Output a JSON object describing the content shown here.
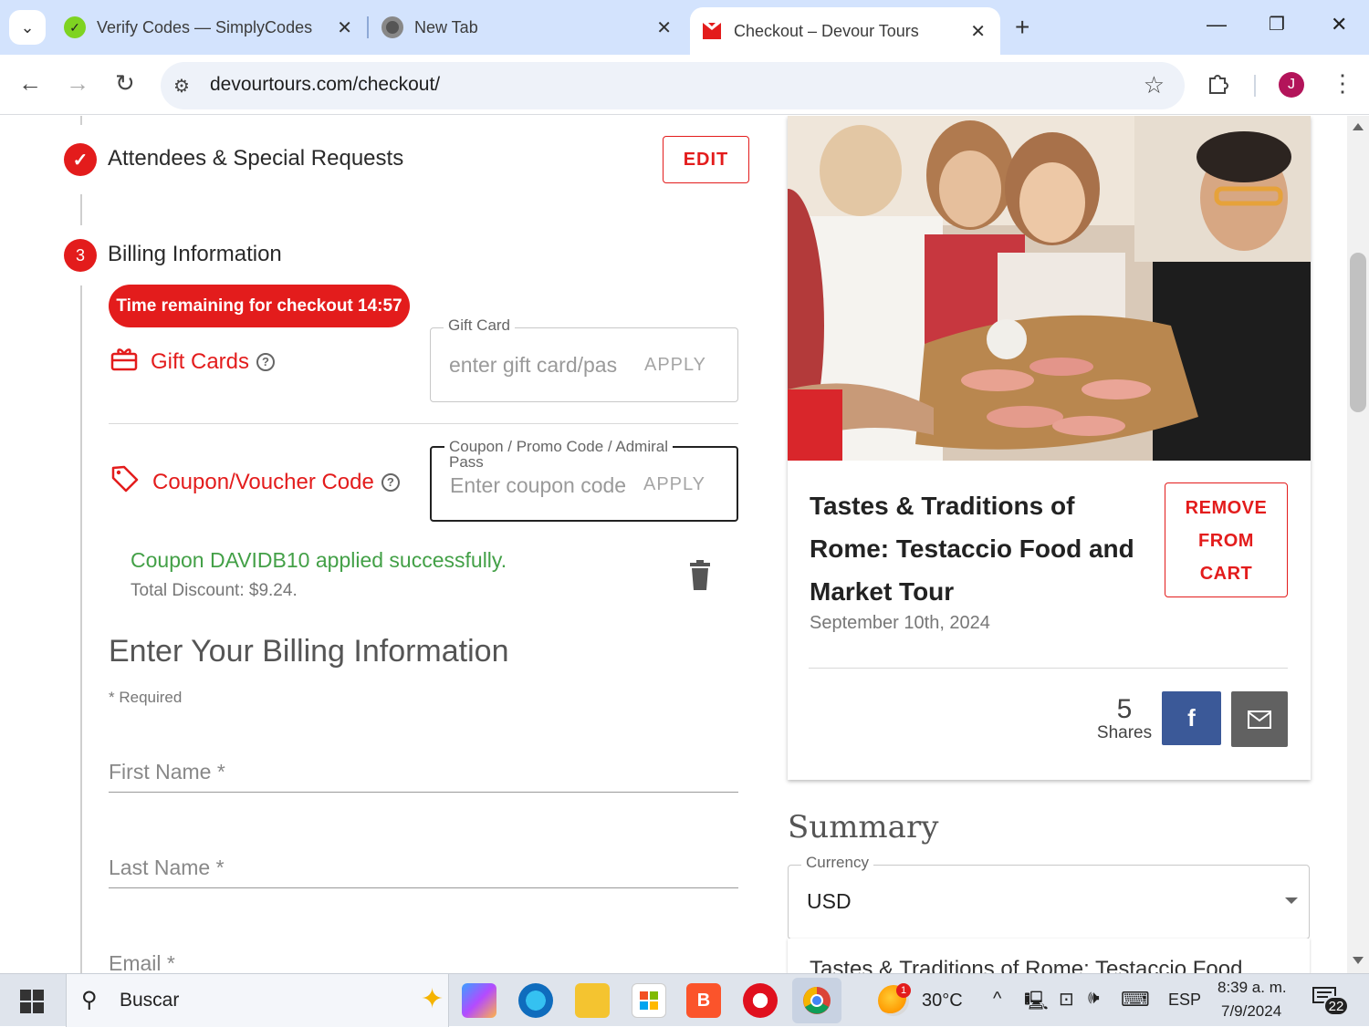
{
  "browser": {
    "tabs": [
      {
        "title": "Verify Codes — SimplyCodes",
        "favicon": "simplycodes-icon"
      },
      {
        "title": "New Tab",
        "favicon": "chrome-icon"
      },
      {
        "title": "Checkout – Devour Tours",
        "favicon": "devour-icon",
        "active": true
      }
    ],
    "url": "devourtours.com/checkout/",
    "profile_initial": "J"
  },
  "checkout": {
    "step_attendees": {
      "title": "Attendees & Special Requests",
      "edit_label": "EDIT"
    },
    "step_billing": {
      "number": "3",
      "title": "Billing Information"
    },
    "timer": "Time remaining for checkout 14:57",
    "gift_cards": {
      "label": "Gift Cards",
      "field_label": "Gift Card",
      "placeholder": "enter gift card/pas",
      "apply": "APPLY"
    },
    "coupon": {
      "label": "Coupon/Voucher Code",
      "field_label_line1": "Coupon / Promo Code / Admiral",
      "field_label_line2": "Pass",
      "placeholder": "Enter coupon code",
      "apply": "APPLY",
      "success": "Coupon DAVIDB10 applied successfully.",
      "discount": "Total Discount: $9.24."
    },
    "billing": {
      "heading": "Enter Your Billing Information",
      "required_note": "* Required",
      "fields": [
        "First Name *",
        "Last Name *",
        "Email *"
      ]
    }
  },
  "cart": {
    "tour_title": "Tastes & Traditions of Rome: Testaccio Food and Market Tour",
    "date": "September 10th, 2024",
    "remove_label": [
      "REMOVE",
      "FROM",
      "CART"
    ],
    "shares_count": "5",
    "shares_label": "Shares"
  },
  "summary": {
    "heading": "Summary",
    "currency_label": "Currency",
    "currency_value": "USD",
    "first_item": "Tastes & Traditions of Rome: Testaccio Food"
  },
  "taskbar": {
    "search": "Buscar",
    "temperature": "30°C",
    "weather_badge": "1",
    "language": "ESP",
    "time": "8:39 a. m.",
    "date": "7/9/2024",
    "notifications": "22"
  },
  "colors": {
    "brand_red": "#e31c1c",
    "success_green": "#43a047",
    "facebook": "#3b5998"
  }
}
